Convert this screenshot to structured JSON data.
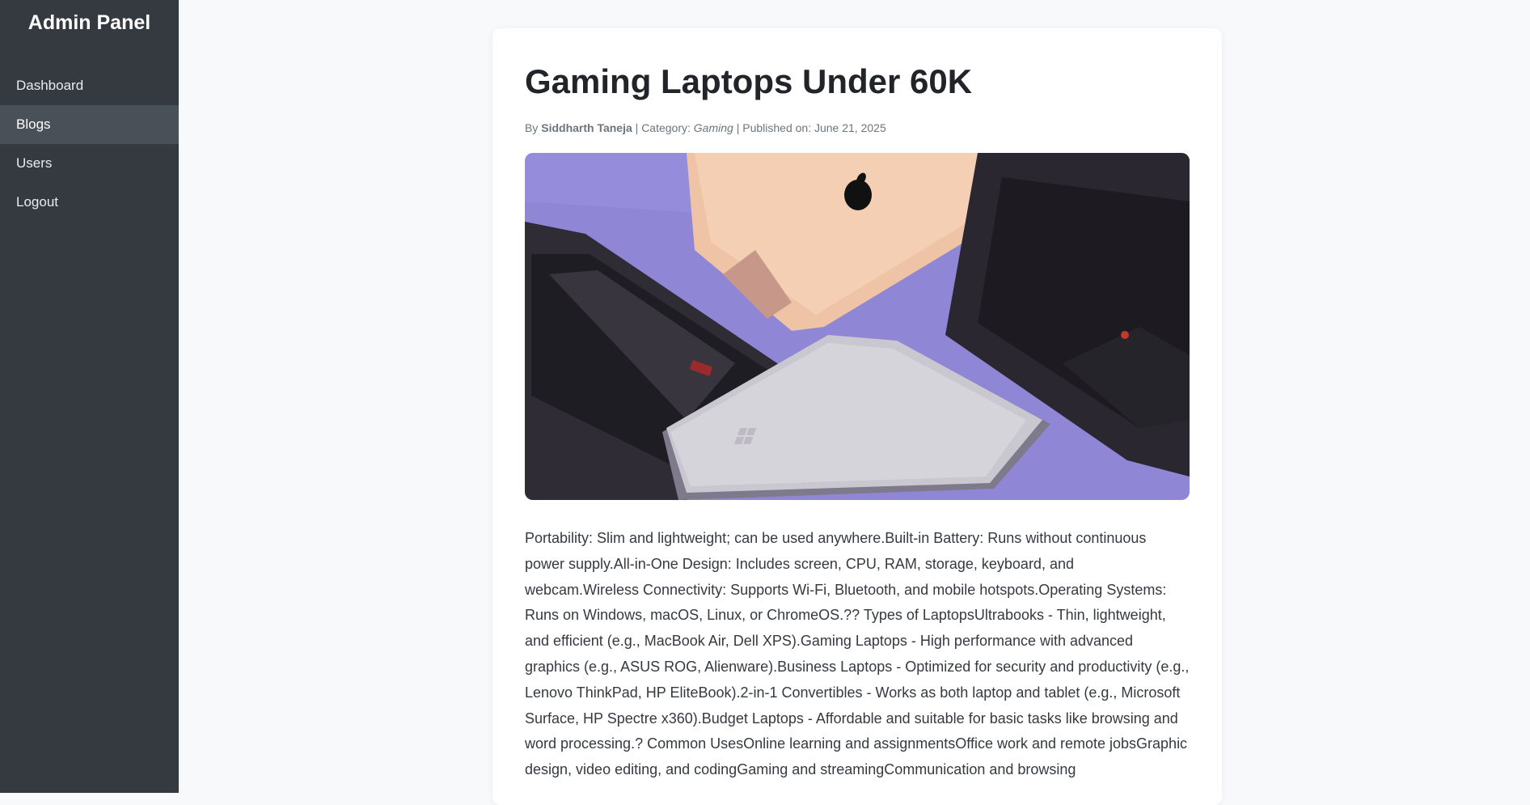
{
  "sidebar": {
    "brand": "Admin Panel",
    "items": [
      {
        "label": "Dashboard",
        "active": false
      },
      {
        "label": "Blogs",
        "active": true
      },
      {
        "label": "Users",
        "active": false
      },
      {
        "label": "Logout",
        "active": false
      }
    ]
  },
  "post": {
    "title": "Gaming Laptops Under 60K",
    "by_prefix": "By",
    "author": "Siddharth Taneja",
    "category_prefix": "| Category:",
    "category": "Gaming",
    "published_prefix": "| Published on:",
    "published_date": "June 21, 2025",
    "image_alt": "laptops",
    "body": "Portability: Slim and lightweight; can be used anywhere.Built-in Battery: Runs without continuous power supply.All-in-One Design: Includes screen, CPU, RAM, storage, keyboard, and webcam.Wireless Connectivity: Supports Wi-Fi, Bluetooth, and mobile hotspots.Operating Systems: Runs on Windows, macOS, Linux, or ChromeOS.?? Types of LaptopsUltrabooks - Thin, lightweight, and efficient (e.g., MacBook Air, Dell XPS).Gaming Laptops - High performance with advanced graphics (e.g., ASUS ROG, Alienware).Business Laptops - Optimized for security and productivity (e.g., Lenovo ThinkPad, HP EliteBook).2-in-1 Convertibles - Works as both laptop and tablet (e.g., Microsoft Surface, HP Spectre x360).Budget Laptops - Affordable and suitable for basic tasks like browsing and word processing.? Common UsesOnline learning and assignmentsOffice work and remote jobsGraphic design, video editing, and codingGaming and streamingCommunication and browsing"
  },
  "colors": {
    "sidebar_bg": "#343a40",
    "sidebar_active": "#495057",
    "page_bg": "#f8f9fa",
    "image_bg": "#8f86d6"
  }
}
